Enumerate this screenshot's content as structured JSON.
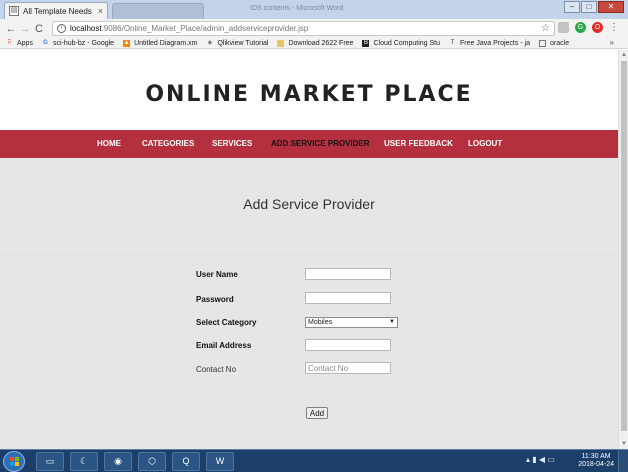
{
  "browser": {
    "tab_title": "All Template Needs",
    "tab_close": "×",
    "window_title": "IDS contents - Microsoft Word",
    "url_host": "localhost",
    "url_path": ":9086/Online_Market_Place/admin_addserviceprovider.jsp",
    "back": "←",
    "forward": "→",
    "reload": "C",
    "star": "☆",
    "menu": "⋮",
    "bookmarks_more": "»",
    "bookmarks": [
      {
        "label": "Apps",
        "icon": "apps-icon"
      },
      {
        "label": "sci-hub-bz - Google",
        "icon": "google-icon"
      },
      {
        "label": "Untitled Diagram.xm",
        "icon": "drawio-icon"
      },
      {
        "label": "Qlikview Tutorial",
        "icon": "qlik-icon"
      },
      {
        "label": "Download 2622 Free",
        "icon": "folder-icon"
      },
      {
        "label": "Cloud Computing Stu",
        "icon": "bookmark-icon"
      },
      {
        "label": "Free Java Projects - ja",
        "icon": "type-icon"
      },
      {
        "label": "oracle",
        "icon": "page-icon"
      }
    ]
  },
  "site": {
    "title": "ONLINE MARKET PLACE",
    "nav": [
      "HOME",
      "CATEGORIES",
      "SERVICES",
      "ADD SERVICE PROVIDER",
      "USER FEEDBACK",
      "LOGOUT"
    ],
    "active_nav": "ADD SERVICE PROVIDER",
    "nav_color": "#b5303e"
  },
  "page": {
    "heading": "Add Service Provider",
    "form": {
      "username_label": "User Name",
      "username_value": "",
      "password_label": "Password",
      "password_value": "",
      "category_label": "Select Category",
      "category_selected": "Mobiles",
      "email_label": "Email Address",
      "email_value": "",
      "contact_label": "Contact No",
      "contact_placeholder": "Contact No",
      "submit_label": "Add"
    }
  },
  "taskbar": {
    "time": "11:30 AM",
    "date": "2018-04-24"
  }
}
